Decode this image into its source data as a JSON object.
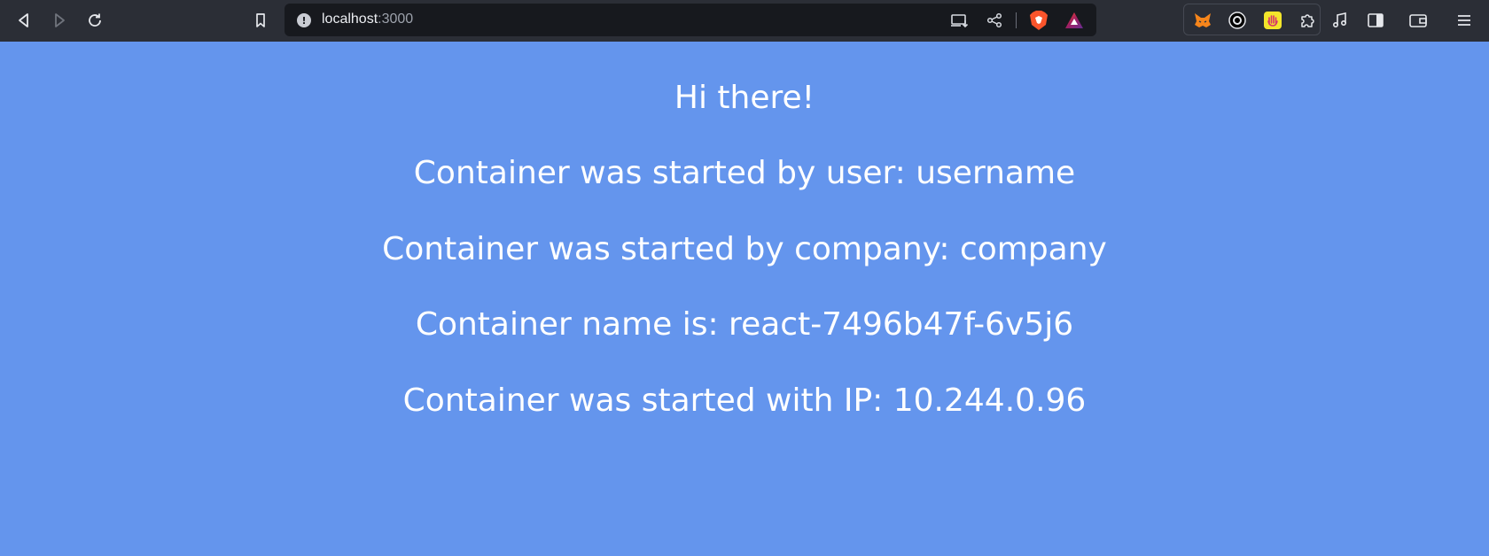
{
  "browser": {
    "url_host": "localhost",
    "url_port": ":3000",
    "icons": {
      "back": "back-icon",
      "forward": "forward-icon",
      "reload": "reload-icon",
      "bookmark": "bookmark-icon",
      "site_info": "site-info-icon",
      "install": "install-app-icon",
      "share": "share-icon",
      "brave_shields": "brave-shields-icon",
      "brave_rewards": "brave-rewards-icon",
      "metamask": "metamask-icon",
      "ext_circle": "extension-circle-icon",
      "ext_hand": "extension-hand-icon",
      "extensions": "extensions-puzzle-icon",
      "media": "media-music-icon",
      "sidebar": "sidebar-icon",
      "wallet": "wallet-icon",
      "menu": "menu-icon"
    }
  },
  "page": {
    "background": "#6495ed",
    "greeting": "Hi there!",
    "user_line": "Container was started by user: username",
    "company_line": "Container was started by company: company",
    "name_line": "Container name is: react-7496b47f-6v5j6",
    "ip_line": "Container was started with IP: 10.244.0.96"
  }
}
